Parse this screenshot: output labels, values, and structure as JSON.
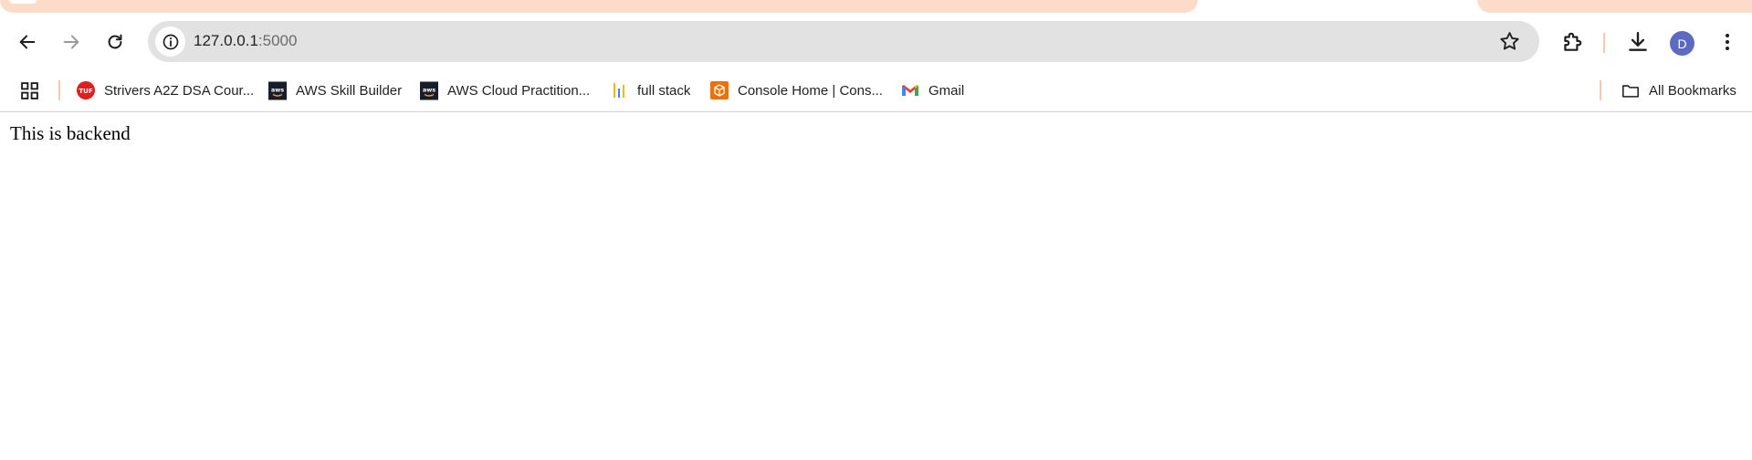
{
  "browser": {
    "address_bar": {
      "host": "127.0.0.1",
      "port": ":5000"
    },
    "profile_initial": "D",
    "icons": {
      "back": "back-arrow-icon",
      "forward": "forward-arrow-icon",
      "reload": "reload-icon",
      "site_info": "info-icon",
      "bookmark_star": "star-icon",
      "extensions": "puzzle-icon",
      "downloads": "download-icon",
      "menu": "kebab-menu-icon"
    },
    "accent_color": "#fddbc9"
  },
  "bookmarks": {
    "apps_icon": "apps-grid-icon",
    "items": [
      {
        "label": "Strivers A2Z DSA Cour...",
        "icon": "tuf-logo-icon"
      },
      {
        "label": "AWS Skill Builder",
        "icon": "aws-logo-icon"
      },
      {
        "label": "AWS Cloud Practition...",
        "icon": "aws-logo-icon"
      },
      {
        "label": "full stack",
        "icon": "bar-chart-icon"
      },
      {
        "label": "Console Home | Cons...",
        "icon": "aws-console-icon"
      },
      {
        "label": "Gmail",
        "icon": "gmail-icon"
      }
    ],
    "all_bookmarks_label": "All Bookmarks"
  },
  "page": {
    "body_text": "This is backend"
  }
}
